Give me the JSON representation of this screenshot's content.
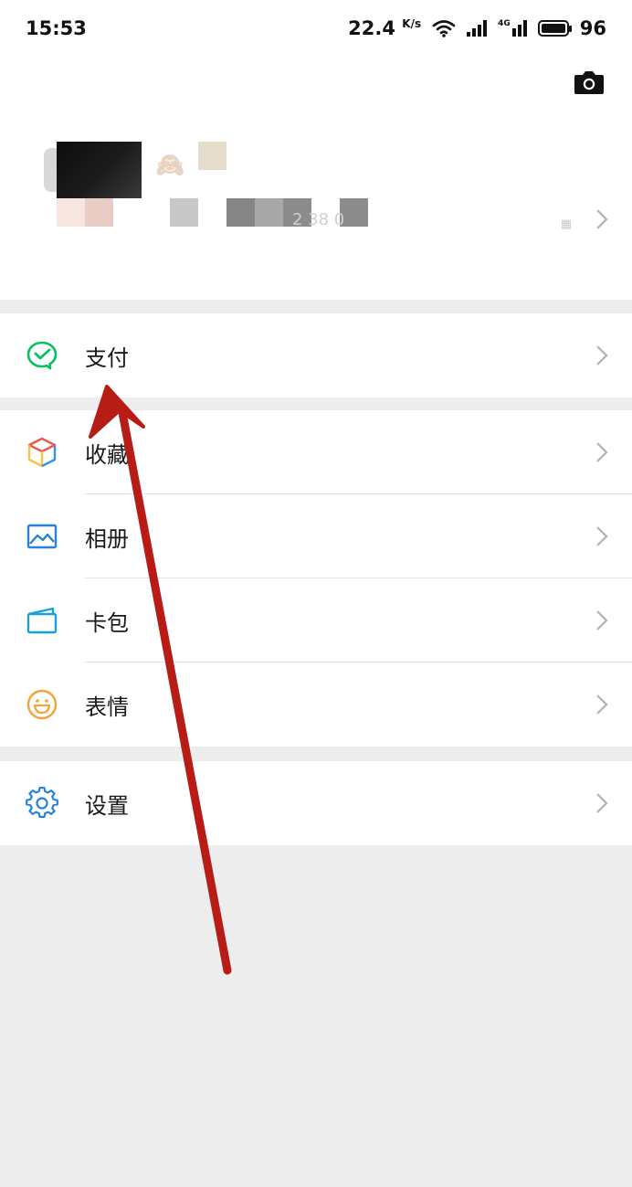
{
  "status_bar": {
    "time": "15:53",
    "net_speed": "22.4",
    "net_unit": "K/s",
    "network_type": "4G",
    "battery": "96"
  },
  "profile": {
    "camera_icon": "camera-icon",
    "wx_id": "2  38  0"
  },
  "menu": {
    "pay": {
      "label": "支付",
      "icon": "wechat-pay-icon",
      "color": "#07c160"
    },
    "items": [
      {
        "label": "收藏",
        "icon": "favorites-cube-icon"
      },
      {
        "label": "相册",
        "icon": "album-icon",
        "color": "#2782d7"
      },
      {
        "label": "卡包",
        "icon": "card-wallet-icon",
        "color": "#1aa0d8"
      },
      {
        "label": "表情",
        "icon": "emoji-icon",
        "color": "#f2a33a"
      }
    ],
    "settings": {
      "label": "设置",
      "icon": "gear-icon",
      "color": "#2782d7"
    }
  },
  "annotation": {
    "arrow_color": "#b81c17"
  }
}
